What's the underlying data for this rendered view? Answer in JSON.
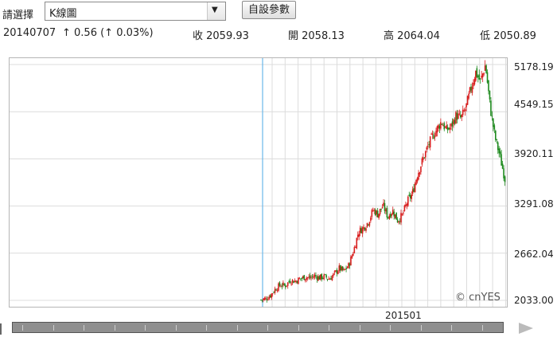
{
  "toolbar": {
    "select_label": "請選擇",
    "select_value": "K線圖",
    "dropdown_arrow": "▼",
    "custom_button": "自設參數"
  },
  "stats": {
    "date": "20140707",
    "change": "↑ 0.56 (↑ 0.03%)",
    "close": "收 2059.93",
    "open": "開 2058.13",
    "high": "高 2064.04",
    "low": "低 2050.89"
  },
  "price_axis": [
    "5178.19",
    "4549.15",
    "3920.11",
    "3291.08",
    "2662.04",
    "2033.00"
  ],
  "x_axis": {
    "label": "201501"
  },
  "watermark": "© cnYES",
  "colors": {
    "up": "#d81e1e",
    "down": "#1f8a1f",
    "cursor": "#6ab7e8",
    "grid": "#dcdcdc"
  },
  "chart_data": {
    "type": "candlestick",
    "ylim": [
      2033.0,
      5178.19
    ],
    "y_ticks": [
      5178.19,
      4549.15,
      3920.11,
      3291.08,
      2662.04,
      2033.0
    ],
    "x_tick_labels": [
      "201501"
    ],
    "grid": true,
    "close_path": [
      2040,
      2055,
      2105,
      2190,
      2240,
      2230,
      2300,
      2290,
      2320,
      2345,
      2330,
      2360,
      2335,
      2350,
      2320,
      2380,
      2460,
      2420,
      2500,
      2700,
      2950,
      3000,
      3080,
      3240,
      3180,
      3300,
      3150,
      3230,
      3100,
      3170,
      3350,
      3450,
      3700,
      3880,
      4050,
      4200,
      4310,
      4420,
      4300,
      4350,
      4500,
      4460,
      4600,
      4850,
      5080,
      4950,
      5178,
      4600,
      4200,
      3950,
      3650
    ]
  }
}
